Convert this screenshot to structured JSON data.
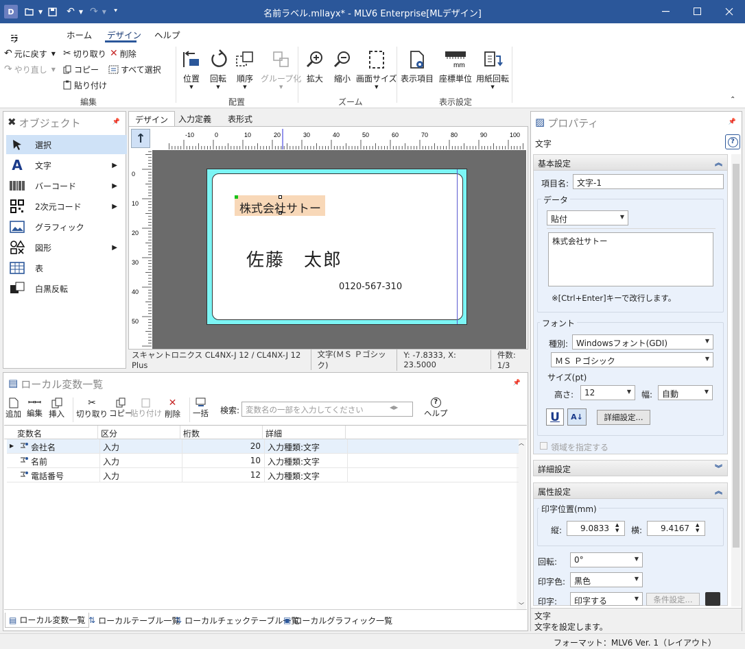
{
  "window": {
    "title": "名前ラベル.mllayx* - MLV6 Enterprise[MLデザイン]",
    "app_icon_letters": "D",
    "brand_color": "#2b579a"
  },
  "menu": {
    "file": "ファイル",
    "home": "ホーム",
    "design": "デザイン",
    "help": "ヘルプ"
  },
  "ribbon": {
    "edit": {
      "undo": "元に戻す",
      "redo": "やり直し",
      "cut": "切り取り",
      "copy": "コピー",
      "paste": "貼り付け",
      "delete": "削除",
      "select_all": "すべて選択",
      "group": "編集"
    },
    "arrange": {
      "position": "位置",
      "rotate": "回転",
      "order": "順序",
      "grouping": "グループ化",
      "group": "配置"
    },
    "zoom": {
      "zoom_in": "拡大",
      "zoom_out": "縮小",
      "screen_size": "画面サイズ",
      "group": "ズーム"
    },
    "display": {
      "display_items": "表示項目",
      "coord_unit": "座標単位",
      "paper_rotate": "用紙回転",
      "unit_label": "mm",
      "group": "表示設定"
    }
  },
  "objects": {
    "title": "オブジェクト",
    "items": [
      {
        "label": "選択",
        "icon": "arrow-cursor-icon",
        "arrow": ""
      },
      {
        "label": "文字",
        "icon": "letter-a-icon",
        "arrow": "▶"
      },
      {
        "label": "バーコード",
        "icon": "barcode-icon",
        "arrow": "▶"
      },
      {
        "label": "2次元コード",
        "icon": "qrcode-icon",
        "arrow": "▶"
      },
      {
        "label": "グラフィック",
        "icon": "picture-icon",
        "arrow": ""
      },
      {
        "label": "図形",
        "icon": "shapes-icon",
        "arrow": "▶"
      },
      {
        "label": "表",
        "icon": "table-icon",
        "arrow": ""
      },
      {
        "label": "白黒反転",
        "icon": "invert-icon",
        "arrow": ""
      }
    ]
  },
  "design": {
    "tabs": [
      "デザイン",
      "入力定義",
      "表形式"
    ],
    "ruler_h": [
      "-10",
      "0",
      "10",
      "20",
      "30",
      "40",
      "50",
      "60",
      "70",
      "80",
      "90",
      "100"
    ],
    "ruler_v": [
      "0",
      "10",
      "20",
      "30",
      "40",
      "50"
    ],
    "label": {
      "company": "株式会社サトー",
      "name": "佐藤　太郎",
      "phone": "0120-567-310"
    },
    "status": {
      "printer": "スキャントロニクス CL4NX-J 12 / CL4NX-J 12 Plus",
      "font": "文字(ＭＳ Ｐゴシック)",
      "coords": "Y: -7.8333, X: 23.5000",
      "count": "件数: 1/3"
    }
  },
  "local_vars": {
    "title": "ローカル変数一覧",
    "toolbar": {
      "add": "追加",
      "edit": "編集",
      "insert": "挿入",
      "cut": "切り取り",
      "copy": "コピー",
      "paste": "貼り付け",
      "delete": "削除",
      "batch": "一括",
      "search_label": "検索:",
      "search_placeholder": "変数名の一部を入力してください",
      "help": "ヘルプ"
    },
    "columns": [
      "変数名",
      "区分",
      "桁数",
      "詳細"
    ],
    "rows": [
      {
        "name": "会社名",
        "kind": "入力",
        "digits": "20",
        "detail": "入力種類:文字"
      },
      {
        "name": "名前",
        "kind": "入力",
        "digits": "10",
        "detail": "入力種類:文字"
      },
      {
        "name": "電話番号",
        "kind": "入力",
        "digits": "12",
        "detail": "入力種類:文字"
      }
    ],
    "bottom_tabs": [
      "ローカル変数一覧",
      "ローカルテーブル一覧",
      "ローカルチェックテーブル一覧",
      "ローカルグラフィック一覧"
    ]
  },
  "properties": {
    "title": "プロパティ",
    "object_type": "文字",
    "basic": {
      "header": "基本設定",
      "item_name_label": "項目名:",
      "item_name": "文字-1",
      "data_label": "データ",
      "data_mode": "貼付",
      "data_text": "株式会社サトー",
      "hint": "※[Ctrl+Enter]キーで改行します。",
      "font_label": "フォント",
      "kind_label": "種別:",
      "kind": "Windowsフォント(GDI)",
      "font_name": "ＭＳ Ｐゴシック",
      "size_label": "サイズ(pt)",
      "height_label": "高さ:",
      "height": "12",
      "width_label": "幅:",
      "width": "自動",
      "detail_button": "詳細設定...",
      "area_check": "領域を指定する"
    },
    "detail_header": "詳細設定",
    "attr": {
      "header": "属性設定",
      "pos_label": "印字位置(mm)",
      "v_label": "縦:",
      "v": "9.0833",
      "h_label": "横:",
      "h": "9.4167",
      "rot_label": "回転:",
      "rot": "0°",
      "color_label": "印字色:",
      "color": "黒色",
      "print_label": "印字:",
      "print": "印字する",
      "cond_button": "条件設定..."
    },
    "desc_title": "文字",
    "desc_text": "文字を設定します。"
  },
  "statusbar": {
    "format": "フォーマット：MLV6 Ver. 1（レイアウト）"
  }
}
